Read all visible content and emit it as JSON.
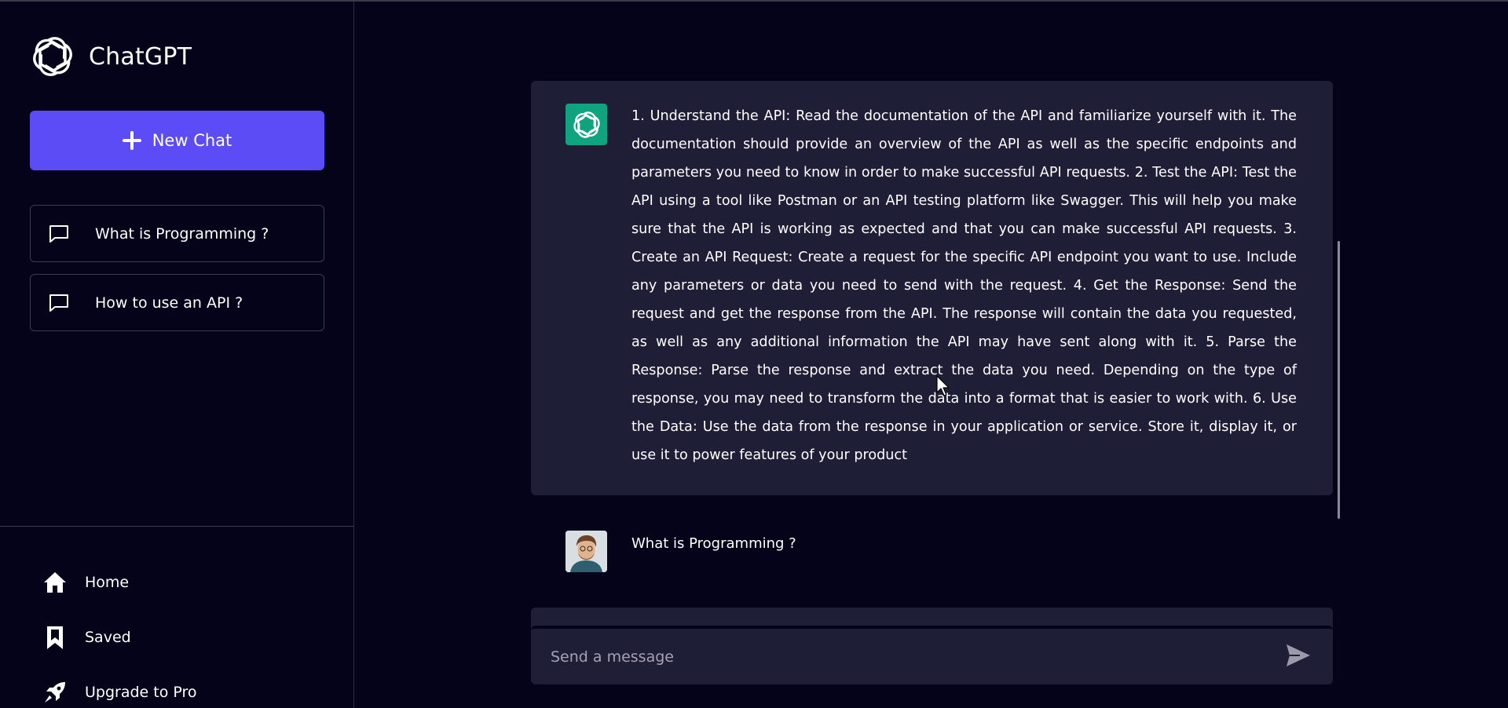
{
  "app": {
    "name": "ChatGPT"
  },
  "sidebar": {
    "new_chat_label": "New Chat",
    "history": [
      {
        "label": "What is Programming ?"
      },
      {
        "label": "How to use an API ?"
      }
    ],
    "nav": [
      {
        "label": "Home",
        "icon": "home-icon"
      },
      {
        "label": "Saved",
        "icon": "bookmark-icon"
      },
      {
        "label": "Upgrade to Pro",
        "icon": "rocket-icon"
      }
    ]
  },
  "conversation": {
    "bot_message": "1. Understand the API: Read the documentation of the API and familiarize yourself with it. The documentation should provide an overview of the API as well as the specific endpoints and parameters you need to know in order to make successful API requests. 2. Test the API: Test the API using a tool like Postman or an API testing platform like Swagger. This will help you make sure that the API is working as expected and that you can make successful API requests. 3. Create an API Request: Create a request for the specific API endpoint you want to use. Include any parameters or data you need to send with the request. 4. Get the Response: Send the request and get the response from the API. The response will contain the data you requested, as well as any additional information the API may have sent along with it. 5. Parse the Response: Parse the response and extract the data you need. Depending on the type of response, you may need to transform the data into a format that is easier to work with. 6. Use the Data: Use the data from the response in your application or service. Store it, display it, or use it to power features of your product",
    "user_message": "What is Programming ?"
  },
  "composer": {
    "placeholder": "Send a message"
  },
  "colors": {
    "background": "#04031a",
    "accent": "#5b4cf6",
    "bubble": "#1e1e36",
    "bot_avatar": "#10a37f"
  }
}
